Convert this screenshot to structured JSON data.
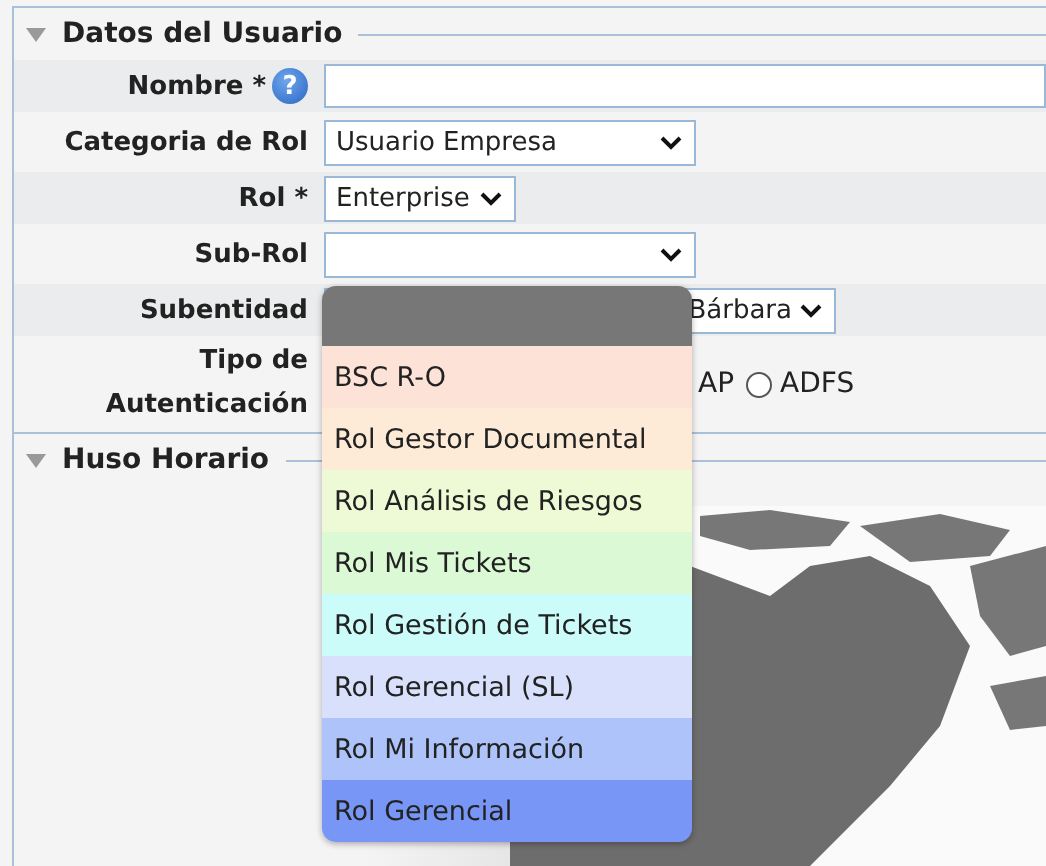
{
  "user_section": {
    "title": "Datos del Usuario",
    "expanded": true,
    "fields": [
      {
        "kind": "text",
        "label": "Nombre *",
        "help": "?"
      },
      {
        "kind": "select",
        "label": "Categoria de Rol",
        "value": "Usuario Empresa"
      },
      {
        "kind": "select",
        "label": "Rol *",
        "value": "Enterprise"
      },
      {
        "kind": "select",
        "label": "Sub-Rol"
      },
      {
        "kind": "select",
        "label": "Subentidad",
        "value": "Bárbara"
      },
      {
        "kind": "radios",
        "label": "Tipo de Autenticación",
        "options": [
          {
            "kind": "cut",
            "label": "AP"
          },
          {
            "kind": "radio",
            "label": "ADFS",
            "selected": false
          }
        ]
      }
    ]
  },
  "timezone_section": {
    "title": "Huso Horario",
    "expanded": true
  },
  "dropdown": {
    "blank_option": {
      "selected": true
    },
    "options": [
      {
        "label": "BSC R-O",
        "color": "#fde2d8",
        "selected": false
      },
      {
        "label": "Rol Gestor Documental",
        "color": "#fdebd8",
        "selected": false
      },
      {
        "label": "Rol Análisis de Riesgos",
        "color": "#eefad5",
        "selected": false
      },
      {
        "label": "Rol Mis Tickets",
        "color": "#dcf9d6",
        "selected": false
      },
      {
        "label": "Rol Gestión de Tickets",
        "color": "#ccfcf9",
        "selected": false
      },
      {
        "label": "Rol Gerencial (SL)",
        "color": "#d8e0fb",
        "selected": false
      },
      {
        "label": "Rol Mi Información",
        "color": "#adc3f9",
        "selected": false
      },
      {
        "label": "Rol Gerencial",
        "color": "#7896f5",
        "selected": false
      }
    ]
  }
}
